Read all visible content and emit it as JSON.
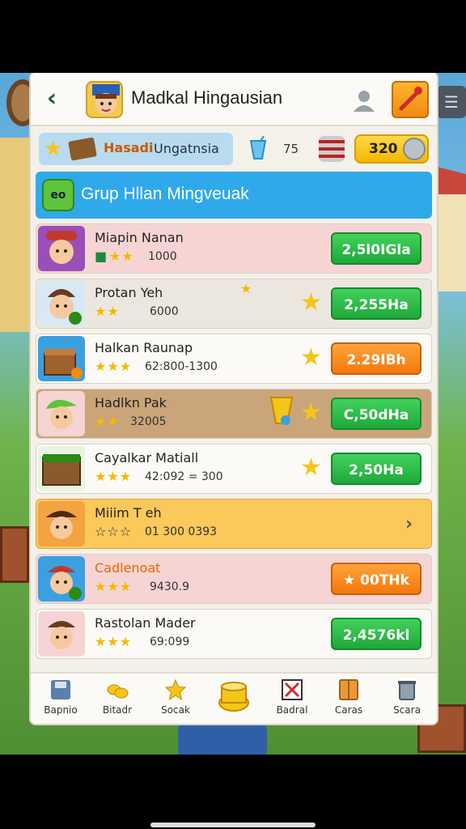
{
  "header": {
    "title": "Madkal Hingausian"
  },
  "resources": {
    "label_orange": "Hasadi",
    "label_blue": "Ungatnsia",
    "cup_count": "75",
    "coins": "320"
  },
  "group": {
    "title": "Grup Hllan Mingveuak",
    "icon_text": "eo"
  },
  "rows": [
    {
      "name": "Miapin Nanan",
      "stars": "★★",
      "stat": "1000",
      "button": "2,5l0IGla",
      "button_color": "green",
      "bg": "#f6d4d4"
    },
    {
      "name": "Protan Yeh",
      "stars": "★★",
      "stat": "6000",
      "button": "2,255Ha",
      "button_color": "green",
      "bg": "#ebe7df"
    },
    {
      "name": "Halkan Raunap",
      "stars": "★★★",
      "stat": "62:800-1300",
      "button": "2.29IBh",
      "button_color": "orange",
      "bg": "#fbfaf6"
    },
    {
      "name": "Hadlkn Pak",
      "stars": "★★",
      "stat": "32005",
      "button": "C,50dHa",
      "button_color": "green",
      "bg": "#caa57a"
    },
    {
      "name": "Cayalkar Matiall",
      "stars": "★★★",
      "stat": "42:092 = 300",
      "button": "2,50Ha",
      "button_color": "green",
      "bg": "#fbfaf6"
    },
    {
      "name": "Miiim T eh",
      "stars": "☆☆☆",
      "stat": "01 300 0393",
      "button": "",
      "button_color": "none",
      "bg": "#fbc85a"
    },
    {
      "name": "Cadlenoat",
      "stars": "★★★",
      "stat": "9430.9",
      "button": "★ 00THk",
      "button_color": "orange",
      "bg": "#f6d4d4"
    },
    {
      "name": "Rastolan Mader",
      "stars": "★★★",
      "stat": "69:099",
      "button": "2,4576kl",
      "button_color": "green",
      "bg": "#fbfaf6"
    }
  ],
  "tabs": [
    {
      "label": "Bapnio",
      "icon": "save-icon"
    },
    {
      "label": "Bitadr",
      "icon": "coins-icon"
    },
    {
      "label": "Socak",
      "icon": "star-icon"
    },
    {
      "label": "",
      "icon": "treasure-icon"
    },
    {
      "label": "Badral",
      "icon": "close-box-icon"
    },
    {
      "label": "Caras",
      "icon": "cabinet-icon"
    },
    {
      "label": "Scara",
      "icon": "trash-icon"
    }
  ],
  "colors": {
    "accent_blue": "#2fa9ea",
    "button_green": "#1fa83a",
    "button_orange": "#f3780c",
    "coin_gold": "#f5b800"
  }
}
